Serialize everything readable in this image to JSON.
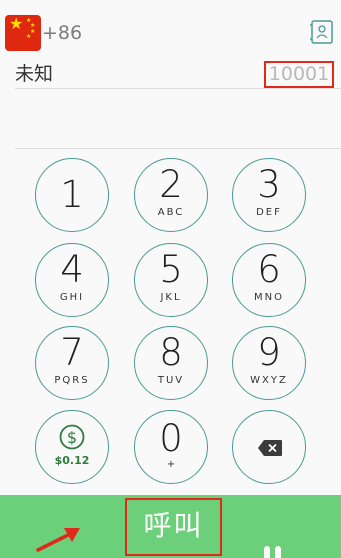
{
  "header": {
    "country_code": "+86"
  },
  "contact": {
    "name": "未知",
    "number": "10001"
  },
  "keypad": {
    "keys": [
      {
        "digit": "1",
        "letters": ""
      },
      {
        "digit": "2",
        "letters": "ABC"
      },
      {
        "digit": "3",
        "letters": "DEF"
      },
      {
        "digit": "4",
        "letters": "GHI"
      },
      {
        "digit": "5",
        "letters": "JKL"
      },
      {
        "digit": "6",
        "letters": "MNO"
      },
      {
        "digit": "7",
        "letters": "PQRS"
      },
      {
        "digit": "8",
        "letters": "TUV"
      },
      {
        "digit": "9",
        "letters": "WXYZ"
      }
    ],
    "balance": "$0.12",
    "zero": {
      "digit": "0",
      "letters": "+"
    }
  },
  "call_bar": {
    "label": "呼叫"
  },
  "colors": {
    "accent_teal": "#4a9a95",
    "call_green": "#6ccf7a",
    "highlight_red": "#e2281b",
    "balance_green": "#2d7c3c"
  },
  "icons": {
    "flag": "china-flag-icon",
    "contacts": "contacts-book-icon",
    "balance": "dollar-icon",
    "delete": "backspace-icon",
    "annotation": "red-arrow-icon"
  }
}
